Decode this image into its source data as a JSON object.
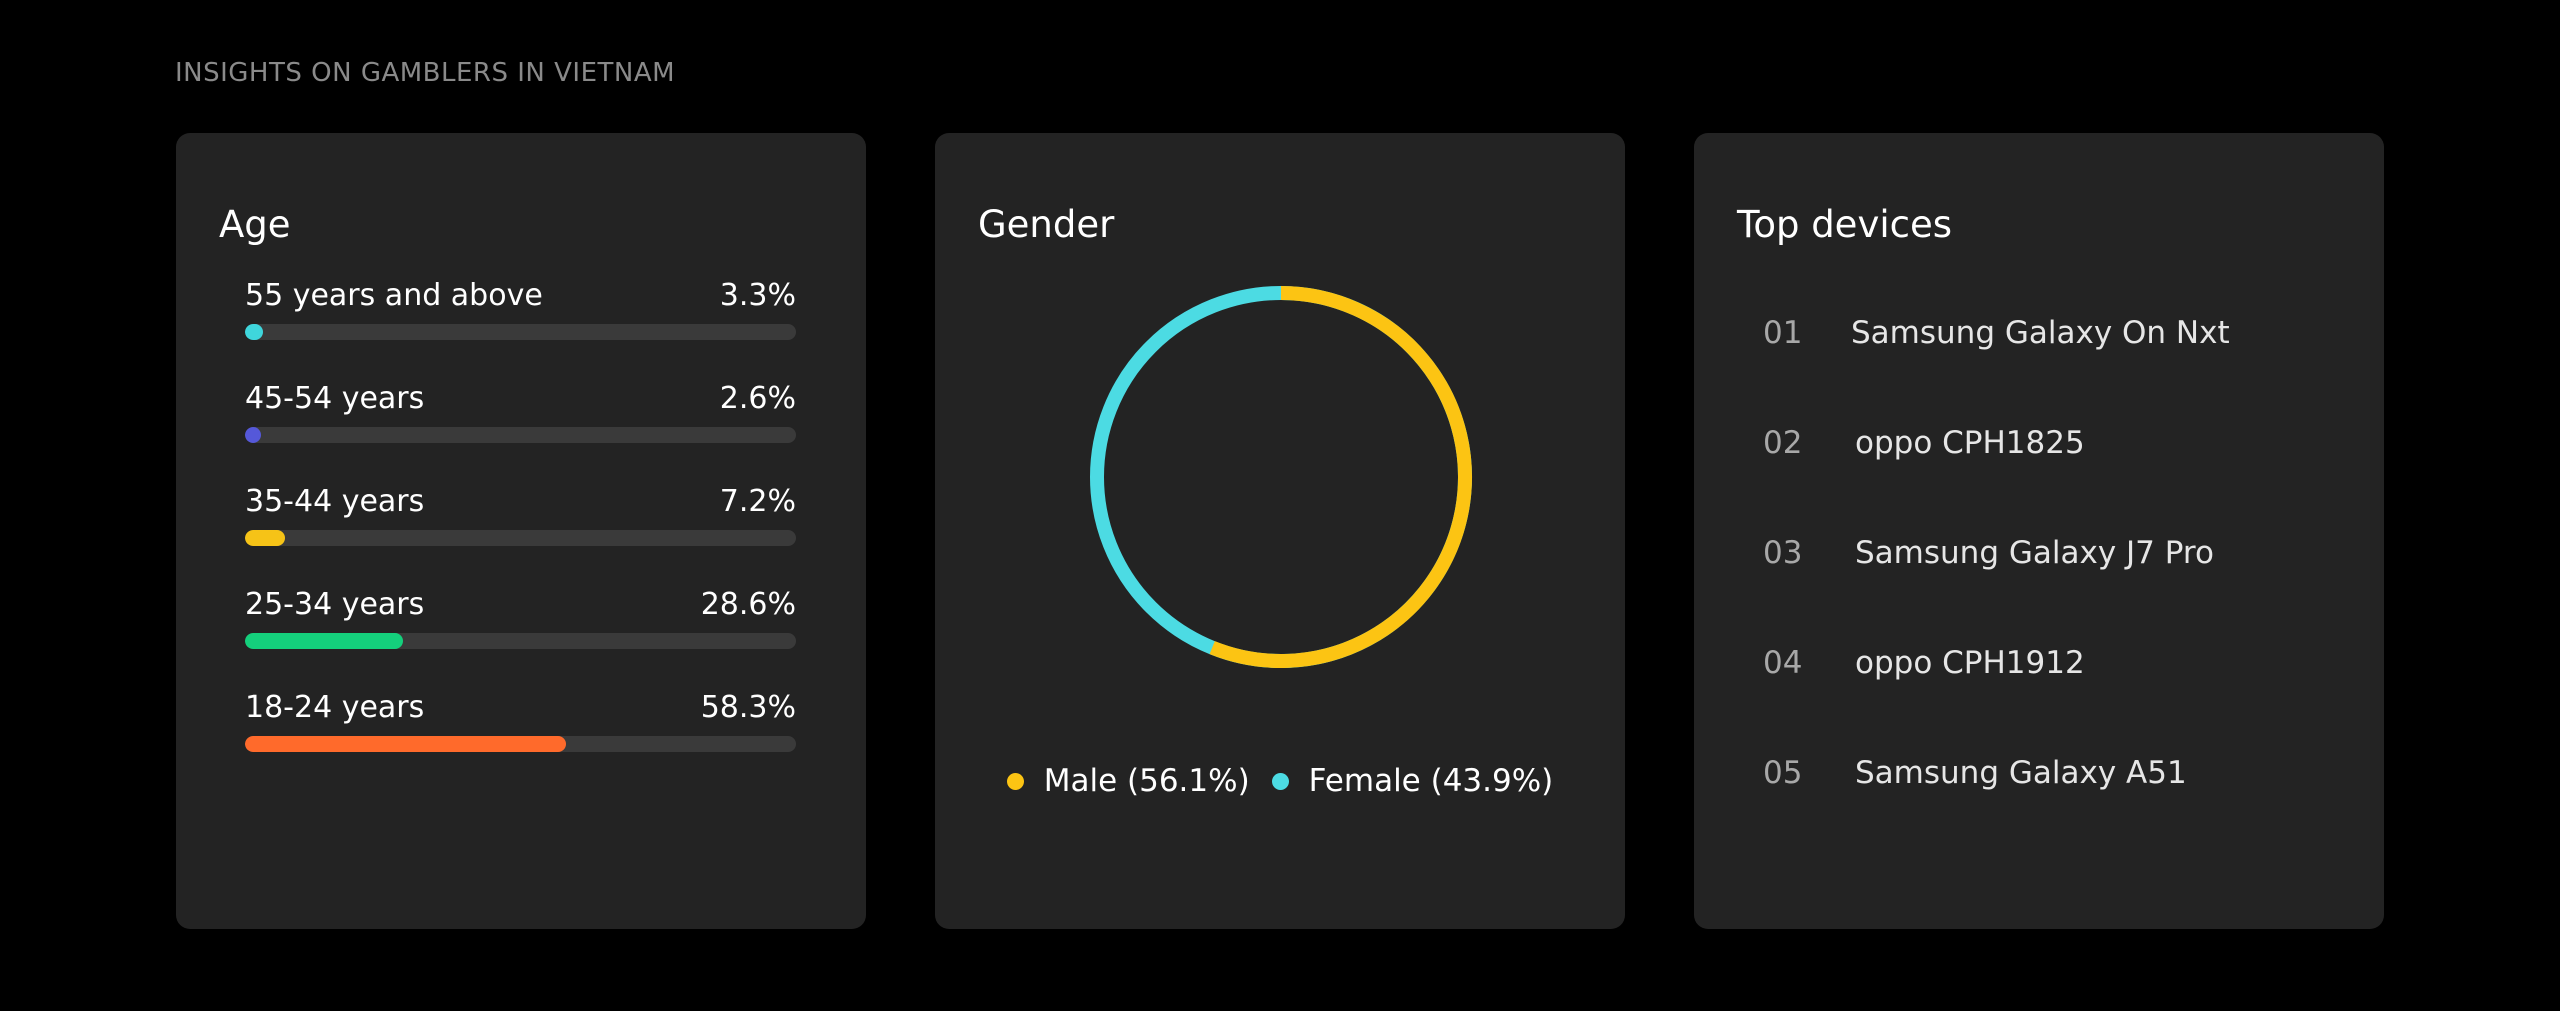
{
  "page": {
    "heading": "INSIGHTS ON GAMBLERS IN VIETNAM"
  },
  "age": {
    "title": "Age",
    "rows": [
      {
        "label": "55 years and above",
        "value_text": "3.3%",
        "value": 3.3,
        "color": "#3fd6dc"
      },
      {
        "label": "45-54 years",
        "value_text": "2.6%",
        "value": 2.6,
        "color": "#5558d9"
      },
      {
        "label": "35-44 years",
        "value_text": "7.2%",
        "value": 7.2,
        "color": "#f6c317"
      },
      {
        "label": "25-34 years",
        "value_text": "28.6%",
        "value": 28.6,
        "color": "#14d07c"
      },
      {
        "label": "18-24 years",
        "value_text": "58.3%",
        "value": 58.3,
        "color": "#ff6a2b"
      }
    ]
  },
  "gender": {
    "title": "Gender",
    "legend": [
      {
        "label": "Male (56.1%)",
        "color": "#fcc413"
      },
      {
        "label": "Female (43.9%)",
        "color": "#4cdbe3"
      }
    ]
  },
  "devices": {
    "title": "Top devices",
    "items": [
      {
        "rank": "01",
        "name": "Samsung Galaxy On Nxt"
      },
      {
        "rank": "02",
        "name": "oppo CPH1825"
      },
      {
        "rank": "03",
        "name": "Samsung Galaxy J7 Pro"
      },
      {
        "rank": "04",
        "name": "oppo CPH1912"
      },
      {
        "rank": "05",
        "name": "Samsung Galaxy A51"
      }
    ]
  },
  "chart_data": [
    {
      "type": "bar",
      "title": "Age",
      "orientation": "horizontal",
      "categories": [
        "55 years and above",
        "45-54 years",
        "35-44 years",
        "25-34 years",
        "18-24 years"
      ],
      "values": [
        3.3,
        2.6,
        7.2,
        28.6,
        58.3
      ],
      "xlim": [
        0,
        100
      ],
      "colors": [
        "#3fd6dc",
        "#5558d9",
        "#f6c317",
        "#14d07c",
        "#ff6a2b"
      ]
    },
    {
      "type": "pie",
      "title": "Gender",
      "donut": true,
      "categories": [
        "Male",
        "Female"
      ],
      "values": [
        56.1,
        43.9
      ],
      "colors": [
        "#fcc413",
        "#4cdbe3"
      ],
      "legend": "bottom"
    }
  ]
}
